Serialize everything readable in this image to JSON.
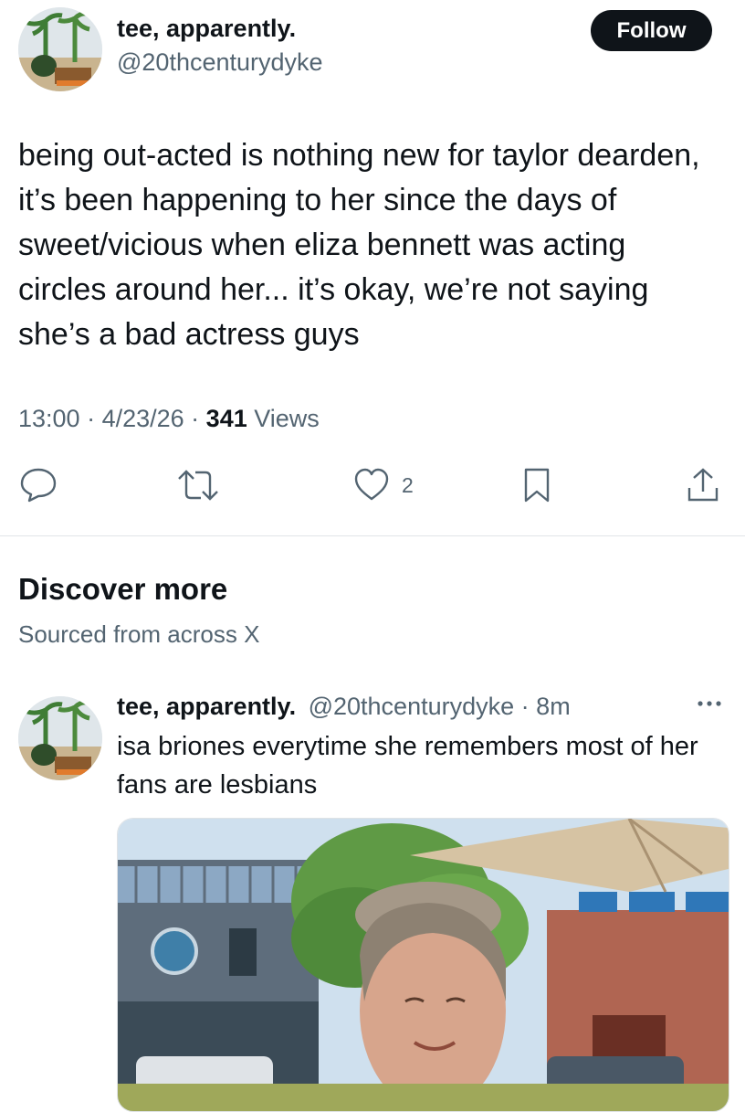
{
  "tweet": {
    "author_name": "tee, apparently.",
    "author_handle": "@20thcenturydyke",
    "follow_label": "Follow",
    "text": "being out-acted is nothing new for taylor dearden, it’s been happening to her since the days of sweet/vicious when eliza bennett was acting circles around her... it’s okay, we’re not saying she’s a bad actress guys",
    "time": "13:00",
    "date": "4/23/26",
    "separator": " · ",
    "views_count": "341",
    "views_label": " Views",
    "like_count": "2"
  },
  "actions": {
    "reply_icon": "reply-icon",
    "retweet_icon": "retweet-icon",
    "like_icon": "heart-icon",
    "bookmark_icon": "bookmark-icon",
    "share_icon": "share-icon"
  },
  "discover": {
    "title": "Discover more",
    "subtitle": "Sourced from across X"
  },
  "post2": {
    "author_name": "tee, apparently.",
    "author_handle": "@20thcenturydyke",
    "dot": "·",
    "age": "8m",
    "text": "isa briones everytime she remembers most of her fans are lesbians"
  },
  "colors": {
    "text": "#0f1419",
    "secondary": "#536471",
    "follow_bg": "#0f1419",
    "divider": "#e1e5e8"
  }
}
